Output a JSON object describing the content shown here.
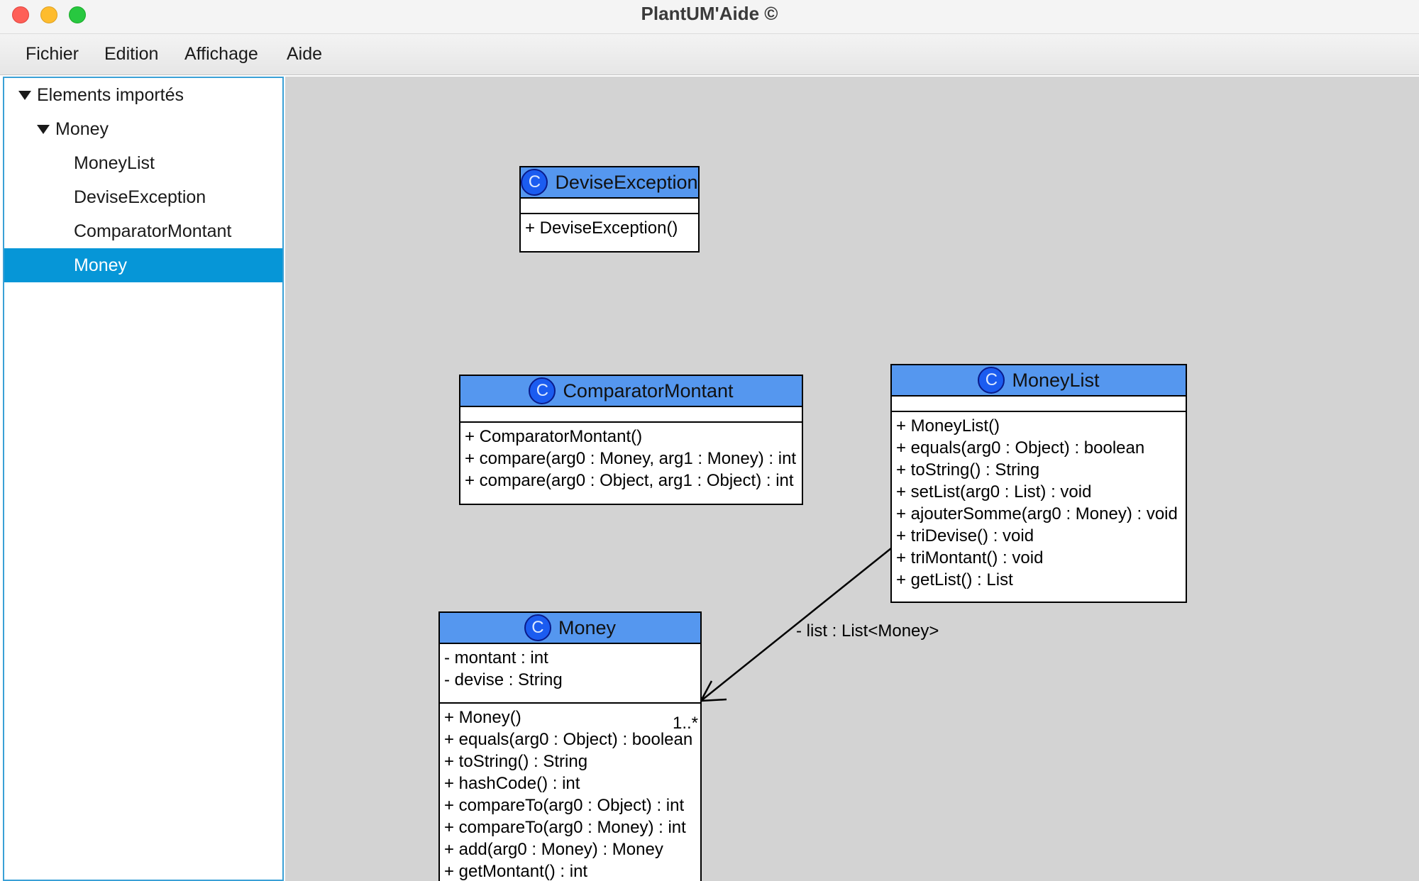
{
  "window": {
    "title": "PlantUM'Aide ©"
  },
  "menu": [
    "Fichier",
    "Edition",
    "Affichage",
    "Aide"
  ],
  "tree": {
    "root": "Elements importés",
    "package": "Money",
    "classes": [
      "MoneyList",
      "DeviseException",
      "ComparatorMontant",
      "Money"
    ],
    "selected": "Money"
  },
  "diagram": {
    "badge": "C",
    "classes": {
      "devise_exception": {
        "name": "DeviseException",
        "attributes": [],
        "methods": [
          "+ DeviseException()"
        ]
      },
      "comparator_montant": {
        "name": "ComparatorMontant",
        "attributes": [],
        "methods": [
          "+ ComparatorMontant()",
          "+ compare(arg0 : Money, arg1 : Money) : int",
          "+ compare(arg0 : Object, arg1 : Object) : int"
        ]
      },
      "money_list": {
        "name": "MoneyList",
        "attributes": [],
        "methods": [
          "+ MoneyList()",
          "+ equals(arg0 : Object) : boolean",
          "+ toString() : String",
          "+ setList(arg0 : List) : void",
          "+ ajouterSomme(arg0 : Money) : void",
          "+ triDevise() : void",
          "+ triMontant() : void",
          "+ getList() : List"
        ]
      },
      "money": {
        "name": "Money",
        "attributes": [
          "- montant : int",
          "- devise : String"
        ],
        "methods": [
          "+ Money()",
          "+ equals(arg0 : Object) : boolean",
          "+ toString() : String",
          "+ hashCode() : int",
          "+ compareTo(arg0 : Object) : int",
          "+ compareTo(arg0 : Money) : int",
          "+ add(arg0 : Money) : Money",
          "+ getMontant() : int"
        ]
      }
    },
    "association": {
      "label": "-  list   : List<Money>",
      "multiplicity": "1..*"
    }
  }
}
